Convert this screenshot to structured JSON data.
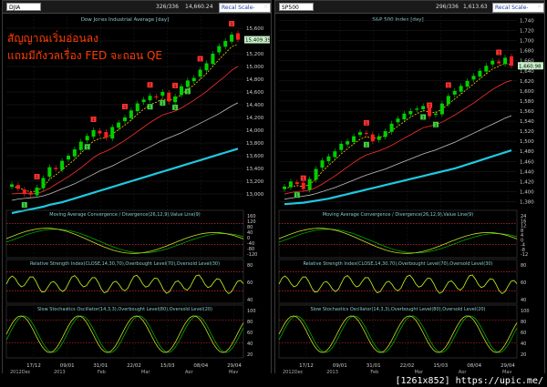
{
  "left": {
    "symbol": "DJIA",
    "count": "326/336",
    "last": "14,660.24",
    "scale_button": "Recal Scale-Linear",
    "main_title": "Dow Jones Industrial Average [day]",
    "macd_title": "Moving Average Convergence / Divergence(26,12,9),Value Line(9)",
    "rsi_title": "Relative Strength Index(CLOSE,14,30,70),Overbought Level(70),Oversold Level(30)",
    "stoch_title": "Slow Stochastics Oscillator(14,3,3),Overbought Level(80),Oversold Level(20)",
    "price_flag": "15,409.39",
    "annotation_line1": "สัญญาณเริ่มอ่อนลง",
    "annotation_line2": "แถมมีกังวลเรื่อง FED จะถอน QE"
  },
  "right": {
    "symbol": "SP500",
    "count": "296/336",
    "last": "1,613.63",
    "scale_button": "Recal Scale-Linear",
    "main_title": "S&P 500 Index [day]",
    "macd_title": "Moving Average Convergence / Divergence(26,12,9),Value Line(9)",
    "rsi_title": "Relative Strength Index(CLOSE,14,30,70),Overbought Level(70),Oversold Level(30)",
    "stoch_title": "Slow Stochastics Oscillator(14,3,3),Overbought Level(80),Oversold Level(20)",
    "price_flag": "1,660.98"
  },
  "watermark": "[1261x852] https://upic.me/",
  "colors": {
    "up_candle": "#00d000",
    "down_candle": "#ff2020",
    "ema_fast": "#ffd000",
    "ema_mid": "#ff3030",
    "ema_slow": "#c0c0c0",
    "ema_long": "#20c8e0",
    "osc_line": "#c8e020",
    "signal_line": "#00c000",
    "level_line": "#ff3030",
    "buy_marker": "#40d040",
    "sell_marker": "#ff3030"
  },
  "chart_data": [
    {
      "type": "line",
      "title": "Dow Jones Industrial Average [day]",
      "ylim": [
        12800,
        15800
      ],
      "y_ticks": [
        13000,
        13200,
        13400,
        13600,
        13800,
        14000,
        14200,
        14400,
        14600,
        14800,
        15000,
        15200,
        15400,
        15600
      ],
      "x_tick_labels": [
        "17/12",
        "09/01",
        "31/01",
        "22/02",
        "15/03",
        "08/04",
        "29/04"
      ],
      "x_bottom_labels": [
        "2012Dec",
        "2013",
        "Feb",
        "Mar",
        "Apr",
        "May"
      ],
      "series": [
        {
          "name": "Close",
          "values": [
            13150,
            13080,
            13000,
            12990,
            13100,
            13250,
            13420,
            13390,
            13520,
            13600,
            13700,
            13820,
            13910,
            14000,
            13950,
            13880,
            14050,
            14120,
            14200,
            14310,
            14420,
            14480,
            14540,
            14520,
            14600,
            14450,
            14530,
            14690,
            14780,
            14820,
            14950,
            15050,
            15200,
            15320,
            15400,
            15500,
            15420
          ]
        },
        {
          "name": "EMA fast",
          "values": [
            13120,
            13100,
            13060,
            13030,
            13050,
            13110,
            13230,
            13300,
            13380,
            13460,
            13540,
            13640,
            13740,
            13830,
            13870,
            13880,
            13940,
            14010,
            14080,
            14160,
            14250,
            14330,
            14400,
            14440,
            14490,
            14470,
            14490,
            14560,
            14640,
            14710,
            14800,
            14890,
            15000,
            15110,
            15210,
            15310,
            15350
          ]
        },
        {
          "name": "EMA mid",
          "values": [
            13000,
            13010,
            13010,
            13000,
            13010,
            13040,
            13090,
            13150,
            13210,
            13270,
            13340,
            13410,
            13490,
            13570,
            13630,
            13670,
            13720,
            13780,
            13840,
            13910,
            13980,
            14050,
            14120,
            14180,
            14240,
            14270,
            14300,
            14350,
            14410,
            14470,
            14540,
            14610,
            14690,
            14770,
            14850,
            14940,
            15000
          ]
        },
        {
          "name": "EMA slow",
          "values": [
            12900,
            12920,
            12930,
            12940,
            12950,
            12970,
            13000,
            13040,
            13080,
            13120,
            13160,
            13210,
            13260,
            13310,
            13360,
            13400,
            13440,
            13490,
            13540,
            13590,
            13640,
            13690,
            13740,
            13790,
            13840,
            13880,
            13920,
            13960,
            14010,
            14060,
            14110,
            14160,
            14210,
            14260,
            14320,
            14380,
            14430
          ]
        },
        {
          "name": "EMA long",
          "values": [
            12700,
            12720,
            12740,
            12760,
            12780,
            12800,
            12830,
            12850,
            12870,
            12900,
            12930,
            12960,
            12990,
            13020,
            13050,
            13080,
            13110,
            13140,
            13170,
            13200,
            13230,
            13260,
            13290,
            13320,
            13350,
            13380,
            13410,
            13440,
            13470,
            13500,
            13530,
            13560,
            13590,
            13620,
            13650,
            13680,
            13710
          ]
        }
      ],
      "buy_signals": [
        [
          2,
          "1"
        ],
        [
          12,
          "1"
        ],
        [
          22,
          "1"
        ],
        [
          24,
          "1"
        ],
        [
          26,
          "1"
        ],
        [
          28,
          "1"
        ]
      ],
      "sell_signals": [
        [
          4,
          "1"
        ],
        [
          13,
          "1"
        ],
        [
          18,
          "1"
        ],
        [
          22,
          "1"
        ],
        [
          26,
          "1"
        ],
        [
          30,
          "1"
        ],
        [
          35,
          "1"
        ]
      ]
    },
    {
      "type": "line",
      "title": "S&P 500 Index [day]",
      "ylim": [
        1370,
        1750
      ],
      "y_ticks": [
        1380,
        1400,
        1420,
        1440,
        1460,
        1480,
        1500,
        1520,
        1540,
        1560,
        1580,
        1600,
        1620,
        1640,
        1660,
        1680,
        1700,
        1720,
        1740
      ],
      "x_tick_labels": [
        "17/12",
        "09/01",
        "31/01",
        "22/02",
        "15/03",
        "08/04",
        "29/04"
      ],
      "x_bottom_labels": [
        "2012Dec",
        "2013",
        "Feb",
        "Mar",
        "Apr",
        "May"
      ],
      "series": [
        {
          "name": "Close",
          "values": [
            1410,
            1420,
            1415,
            1405,
            1425,
            1445,
            1462,
            1470,
            1480,
            1495,
            1500,
            1510,
            1518,
            1515,
            1500,
            1510,
            1520,
            1535,
            1545,
            1555,
            1560,
            1565,
            1570,
            1550,
            1555,
            1575,
            1590,
            1600,
            1610,
            1620,
            1630,
            1640,
            1650,
            1660,
            1655,
            1666,
            1650
          ]
        },
        {
          "name": "EMA fast",
          "values": [
            1405,
            1410,
            1412,
            1410,
            1414,
            1425,
            1440,
            1452,
            1463,
            1475,
            1485,
            1495,
            1504,
            1509,
            1506,
            1507,
            1512,
            1521,
            1530,
            1539,
            1548,
            1555,
            1561,
            1558,
            1557,
            1564,
            1574,
            1584,
            1594,
            1604,
            1614,
            1624,
            1634,
            1644,
            1649,
            1655,
            1652
          ]
        },
        {
          "name": "EMA mid",
          "values": [
            1395,
            1398,
            1400,
            1401,
            1403,
            1408,
            1415,
            1423,
            1431,
            1440,
            1449,
            1458,
            1466,
            1473,
            1477,
            1481,
            1486,
            1492,
            1499,
            1506,
            1513,
            1520,
            1527,
            1530,
            1533,
            1538,
            1545,
            1552,
            1560,
            1568,
            1576,
            1585,
            1594,
            1603,
            1610,
            1617,
            1621
          ]
        },
        {
          "name": "EMA slow",
          "values": [
            1385,
            1387,
            1389,
            1391,
            1393,
            1396,
            1400,
            1404,
            1408,
            1413,
            1418,
            1423,
            1428,
            1433,
            1437,
            1441,
            1445,
            1450,
            1455,
            1460,
            1465,
            1470,
            1475,
            1479,
            1483,
            1488,
            1493,
            1498,
            1504,
            1510,
            1516,
            1522,
            1528,
            1534,
            1540,
            1546,
            1551
          ]
        },
        {
          "name": "EMA long",
          "values": [
            1375,
            1376,
            1377,
            1378,
            1380,
            1382,
            1384,
            1386,
            1389,
            1392,
            1395,
            1398,
            1401,
            1404,
            1407,
            1410,
            1413,
            1416,
            1419,
            1422,
            1425,
            1428,
            1431,
            1434,
            1437,
            1440,
            1443,
            1446,
            1450,
            1454,
            1458,
            1462,
            1466,
            1470,
            1474,
            1478,
            1482
          ]
        }
      ],
      "buy_signals": [
        [
          2,
          "1"
        ],
        [
          13,
          "1"
        ],
        [
          22,
          "1"
        ],
        [
          24,
          "1"
        ]
      ],
      "sell_signals": [
        [
          3,
          "1"
        ],
        [
          13,
          "1"
        ],
        [
          23,
          "1"
        ],
        [
          26,
          "1"
        ],
        [
          34,
          "1"
        ]
      ]
    }
  ],
  "macd_ticks_left": [
    "160",
    "120",
    "80",
    "40",
    "0",
    "-40",
    "-80",
    "-120"
  ],
  "macd_ticks_right": [
    "24",
    "16",
    "12",
    "8",
    "4",
    "0",
    "-4",
    "-8",
    "-12"
  ],
  "rsi_ticks": [
    "80",
    "60",
    "40"
  ],
  "stoch_ticks": [
    "100",
    "80",
    "60",
    "40",
    "20"
  ]
}
